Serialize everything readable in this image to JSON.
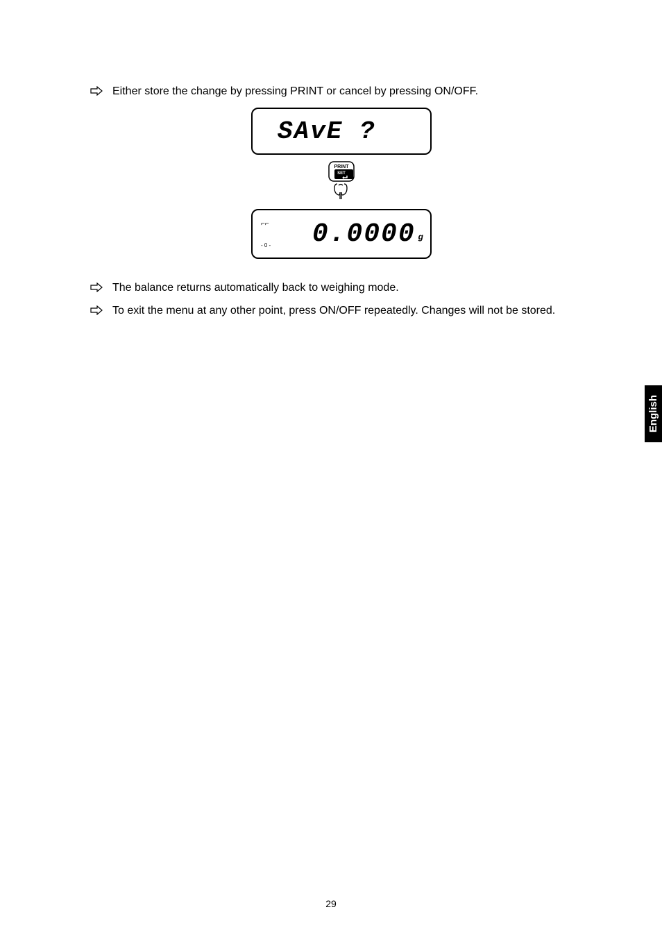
{
  "instructions": {
    "step1": "Either store the change by pressing PRINT or cancel by pressing ON/OFF.",
    "step2": "The balance returns automatically back to weighing mode.",
    "step3": "To exit the menu at any other point, press ON/OFF repeatedly. Changes will not be stored."
  },
  "display1": {
    "text": "SAvE ?"
  },
  "display2": {
    "value": "0.0000",
    "unit": "g",
    "indicator_top": "⌐⌐",
    "indicator_bottom": "- 0 -"
  },
  "button": {
    "label_top": "PRINT",
    "label_mid": "SET"
  },
  "side_tab": "English",
  "page_number": "29"
}
